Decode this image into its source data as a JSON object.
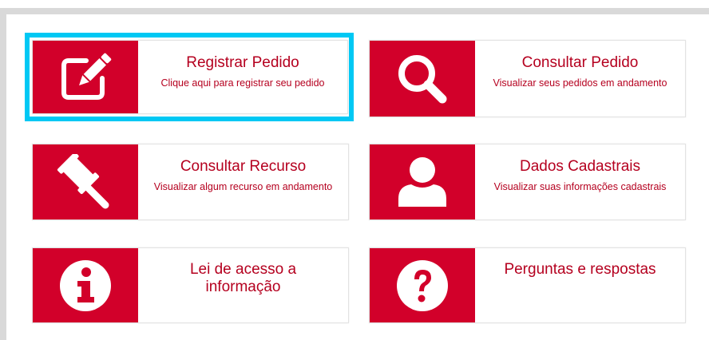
{
  "cards": [
    {
      "title": "Registrar Pedido",
      "subtitle": "Clique aqui para registrar seu pedido",
      "icon": "edit-icon"
    },
    {
      "title": "Consultar Pedido",
      "subtitle": "Visualizar seus pedidos em andamento",
      "icon": "search-icon"
    },
    {
      "title": "Consultar Recurso",
      "subtitle": "Visualizar algum recurso em andamento",
      "icon": "gavel-icon"
    },
    {
      "title": "Dados Cadastrais",
      "subtitle": "Visualizar suas informações cadastrais",
      "icon": "user-icon"
    },
    {
      "title": "Lei de acesso a informação",
      "subtitle": "",
      "icon": "info-icon"
    },
    {
      "title": "Perguntas e respostas",
      "subtitle": "",
      "icon": "question-icon"
    }
  ],
  "colors": {
    "accent": "#d2002a",
    "text": "#b5001f",
    "highlight": "#00c8f4",
    "frame": "#d9d9d9"
  }
}
